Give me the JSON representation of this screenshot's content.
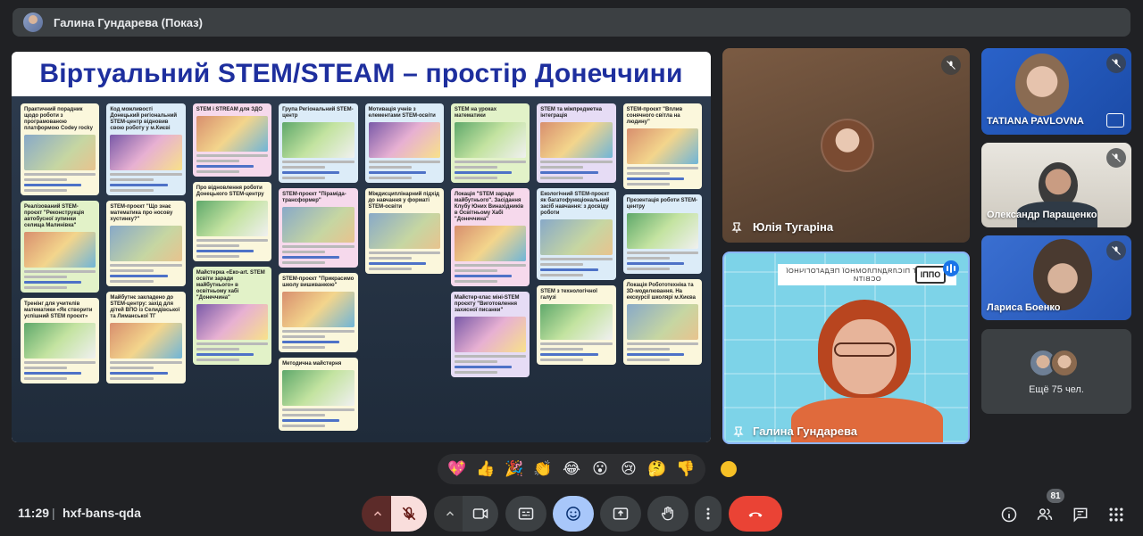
{
  "presenter": {
    "label": "Галина Гундарева (Показ)"
  },
  "slide": {
    "title": "Віртуальний STEM/STEAM – простір Донеччини"
  },
  "padlet_columns": [
    [
      {
        "title": "Практичний порадник щодо роботи з програмованою платформою Codey rocky",
        "img": "a",
        "color": "c-yellow"
      },
      {
        "title": "Реалізований STEM-проєкт \"Реконструкція автобусної зупинки селища Малинівка\"",
        "img": "b",
        "color": "c-green"
      },
      {
        "title": "Тренінг для учителів математики «Як створити успішний STEM проєкт»",
        "img": "c",
        "color": "c-yellow"
      }
    ],
    [
      {
        "title": "Код можливості Донецький регіональний STEM-центр відновив свою роботу у м.Києві",
        "img": "d",
        "color": "c-blue"
      },
      {
        "title": "STEM-проєкт \"Що знає математика про носову хустинку?\"",
        "img": "a",
        "color": "c-yellow"
      },
      {
        "title": "Майбутнє закладено до STEM-центру: захід для дітей ВПО із Селидівської та Лиманської ТГ",
        "img": "b",
        "color": "c-yellow"
      }
    ],
    [
      {
        "title": "STEM і STREAM для ЗДО",
        "img": "b",
        "color": "c-pink"
      },
      {
        "title": "Про відновлення роботи Донецького STEM-центру",
        "img": "c",
        "color": "c-yellow"
      },
      {
        "title": "Майстерка «Еко-art. STEM освіти заради майбутнього» в освітньому хабі \"Донеччина\"",
        "img": "d",
        "color": "c-green"
      }
    ],
    [
      {
        "title": "Група Регіональний STEM-центр",
        "img": "c",
        "color": "c-blue"
      },
      {
        "title": "STEM-проєкт \"Піраміда-трансформер\"",
        "img": "a",
        "color": "c-pink"
      },
      {
        "title": "STEM-проєкт \"Прикрасимо школу вишиванкою\"",
        "img": "b",
        "color": "c-yellow"
      },
      {
        "title": "Методична майстерня",
        "img": "c",
        "color": "c-yellow"
      }
    ],
    [
      {
        "title": "Мотивація учнів з елементами STEM-освіти",
        "img": "d",
        "color": "c-blue"
      },
      {
        "title": "Міждисциплінарний підхід до навчання у форматі STEM-освіти",
        "img": "a",
        "color": "c-yellow"
      }
    ],
    [
      {
        "title": "STEM на уроках математики",
        "img": "c",
        "color": "c-green"
      },
      {
        "title": "Локація \"STEM заради майбутнього\". Засідання Клубу Юних Винахідників в Освітньому Хабі \"Донеччина\"",
        "img": "b",
        "color": "c-pink"
      },
      {
        "title": "Майстер-клас міні-STEM проєкту \"Виготовлення захисної писанки\"",
        "img": "d",
        "color": "c-purple"
      }
    ],
    [
      {
        "title": "STEM та міжпредметна інтеграція",
        "img": "b",
        "color": "c-purple"
      },
      {
        "title": "Екологічний STEM-проєкт як багатофункціональний засіб навчання: з досвіду роботи",
        "img": "a",
        "color": "c-blue"
      },
      {
        "title": "STEM з технологічної галузі",
        "img": "c",
        "color": "c-yellow"
      }
    ],
    [
      {
        "title": "STEM-проєкт \"Вплив сонячного світла на людину\"",
        "img": "b",
        "color": "c-yellow"
      },
      {
        "title": "Презентація роботи STEM-центру",
        "img": "c",
        "color": "c-blue"
      },
      {
        "title": "Локація Робототехніка та 3D-моделювання. На екскурсії школярі м.Києва",
        "img": "a",
        "color": "c-yellow"
      }
    ]
  ],
  "tiles": {
    "julia": {
      "name": "Юлія Тугаріна"
    },
    "galina": {
      "name": "Галина Гундарева",
      "banner": "ІНСТИТУТ ПІСЛЯДИПЛОМНОЇ ПЕДАГОГІЧНОЇ ОСВІТИ",
      "logo": "ОППІ"
    },
    "tatiana": {
      "name": "TATIANA PAVLOVNA"
    },
    "olexandr": {
      "name": "Олександр Паращенко"
    },
    "larysa": {
      "name": "Лариса Боенко"
    },
    "more": {
      "label": "Ещё 75 чел."
    }
  },
  "reactions": [
    "💖",
    "👍",
    "🎉",
    "👏",
    "😂",
    "😮",
    "😢",
    "🤔",
    "👎"
  ],
  "bottom": {
    "time": "11:29",
    "separator": "|",
    "meeting_code": "hxf-bans-qda",
    "participants_badge": "81"
  },
  "colors": {
    "background": "#202124",
    "control": "#3c4043",
    "mic_off": "#f9dedc",
    "end_call": "#ea4335",
    "emoji_active": "#a8c7fa"
  }
}
